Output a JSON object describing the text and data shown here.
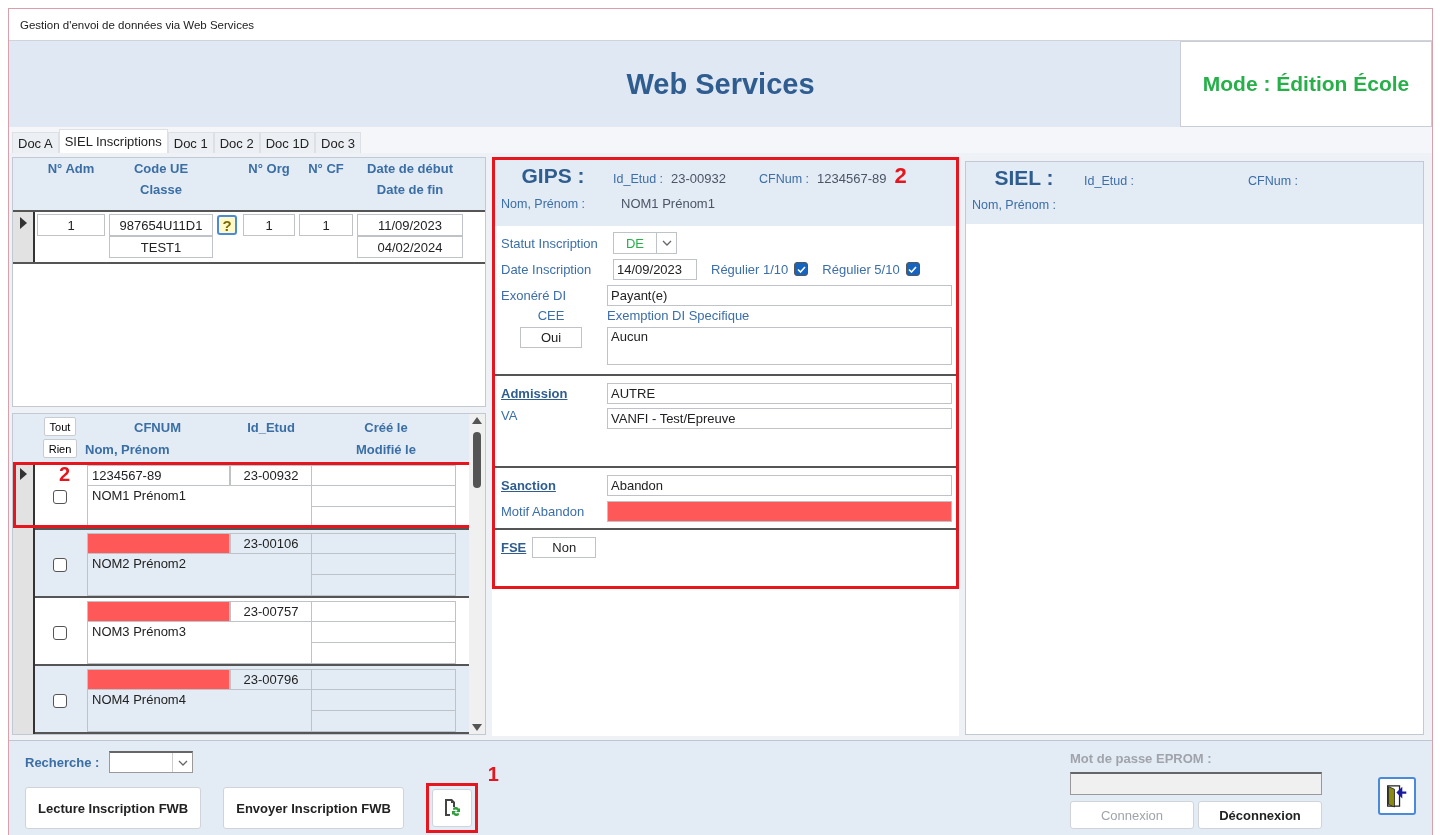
{
  "window": {
    "title": "Gestion d'envoi de données via Web Services"
  },
  "header": {
    "title": "Web Services",
    "mode": "Mode : Édition École"
  },
  "tabs": [
    {
      "label": "Doc A",
      "selected": false
    },
    {
      "label": "SIEL Inscriptions",
      "selected": true
    },
    {
      "label": "Doc 1",
      "selected": false
    },
    {
      "label": "Doc 2",
      "selected": false
    },
    {
      "label": "Doc 1D",
      "selected": false
    },
    {
      "label": "Doc 3",
      "selected": false
    }
  ],
  "classes_grid": {
    "columns": [
      {
        "label": "N° Adm"
      },
      {
        "label": "Code UE",
        "sublabel": "Classe"
      },
      {
        "label": "N° Org"
      },
      {
        "label": "N° CF"
      },
      {
        "label": "Date de début",
        "sublabel": "Date de fin"
      }
    ],
    "rows": [
      {
        "current": true,
        "adm": "1",
        "code_ue": "987654U11D1",
        "classe": "TEST1",
        "help": "?",
        "org": "1",
        "cf": "1",
        "date_debut": "11/09/2023",
        "date_fin": "04/02/2024"
      }
    ]
  },
  "students": {
    "select_all": "Tout",
    "select_none": "Rien",
    "columns": {
      "cfnum": "CFNUM",
      "name": "Nom, Prénom",
      "id": "Id_Etud",
      "created": "Créé le",
      "modified": "Modifié le"
    },
    "rows": [
      {
        "current": true,
        "callout": "2",
        "checked": false,
        "cfnum": "1234567-89",
        "cfnum_missing": false,
        "id": "23-00932",
        "name": "NOM1 Prénom1"
      },
      {
        "current": false,
        "checked": false,
        "cfnum_missing": true,
        "id": "23-00106",
        "name": "NOM2 Prénom2"
      },
      {
        "current": false,
        "checked": false,
        "cfnum_missing": true,
        "id": "23-00757",
        "name": "NOM3 Prénom3"
      },
      {
        "current": false,
        "checked": false,
        "cfnum_missing": true,
        "id": "23-00796",
        "name": "NOM4 Prénom4"
      }
    ]
  },
  "gips": {
    "title": "GIPS :",
    "callout": "2",
    "id_label": "Id_Etud :",
    "id_value": "23-00932",
    "cfnum_label": "CFNum :",
    "cfnum_value": "1234567-89",
    "name_label": "Nom, Prénom :",
    "name_value": "NOM1 Prénom1",
    "statut": {
      "label": "Statut Inscription",
      "value": "DE"
    },
    "date": {
      "label": "Date Inscription",
      "value": "14/09/2023"
    },
    "checks": [
      {
        "label": "Régulier 1/10",
        "checked": true
      },
      {
        "label": "Régulier 5/10",
        "checked": true
      }
    ],
    "exonere": {
      "label": "Exonéré DI",
      "value": "Payant(e)"
    },
    "cee": {
      "label": "CEE",
      "value": "Oui"
    },
    "exemption": {
      "label": "Exemption DI Specifique",
      "value": "Aucun"
    },
    "admission": {
      "label": "Admission",
      "value": "AUTRE"
    },
    "va": {
      "label": "VA",
      "value": "VANFI - Test/Epreuve"
    },
    "sanction": {
      "label": "Sanction",
      "value": "Abandon"
    },
    "motif": {
      "label": "Motif Abandon",
      "missing": true
    },
    "fse": {
      "label": "FSE",
      "value": "Non"
    }
  },
  "siel": {
    "title": "SIEL :",
    "id_label": "Id_Etud :",
    "cfnum_label": "CFNum :",
    "name_label": "Nom, Prénom :"
  },
  "footer": {
    "search_label": "Recherche :",
    "buttons": [
      {
        "label": "Lecture Inscription FWB"
      },
      {
        "label": "Envoyer Inscription FWB"
      }
    ],
    "refresh": {
      "callout": "1"
    },
    "password_label": "Mot de passe EPROM :",
    "connect": {
      "label": "Connexion",
      "disabled": true
    },
    "disconnect": {
      "label": "Déconnexion",
      "disabled": false
    }
  }
}
